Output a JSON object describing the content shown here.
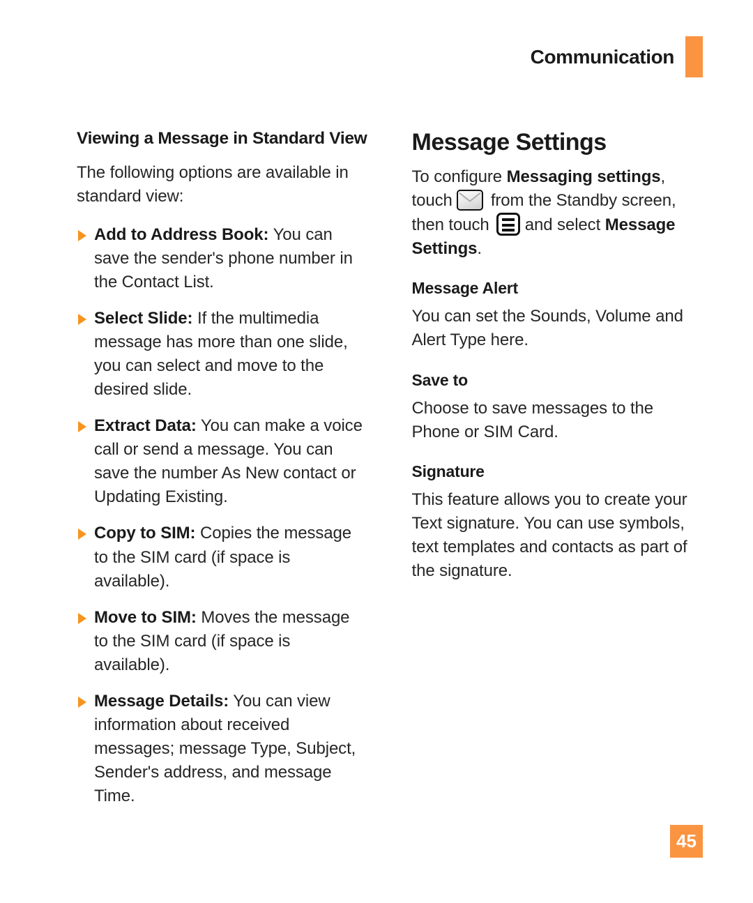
{
  "header": {
    "title": "Communication",
    "tab_color": "#fb9441"
  },
  "left_column": {
    "heading": "Viewing a Message in Standard View",
    "intro": "The following options are available in standard view:",
    "bullets": [
      {
        "term": "Add to Address Book:",
        "text": " You can save the sender's phone number in the Contact List."
      },
      {
        "term": "Select Slide:",
        "text": " If the multimedia message has more than one slide, you can select and move to the desired slide."
      },
      {
        "term": "Extract Data:",
        "text": " You can make a voice call or send a message. You can save the number As New contact or Updating Existing."
      },
      {
        "term": "Copy to SIM:",
        "text": " Copies the message to the SIM card (if space is available)."
      },
      {
        "term": "Move to SIM:",
        "text": " Moves the message to the SIM card (if space is available)."
      },
      {
        "term": "Message Details:",
        "text": " You can view information about received messages; message Type, Subject, Sender's address, and message Time."
      }
    ],
    "bullet_color": "#f7941e"
  },
  "right_column": {
    "heading": "Message Settings",
    "intro": {
      "part1": "To configure ",
      "bold1": "Messaging settings",
      "part2": ", touch ",
      "envelope_icon": "envelope-icon",
      "part3": " from the Standby screen, then touch ",
      "menu_icon": "menu-icon",
      "part4": " and select ",
      "bold2": "Message Settings",
      "part5": "."
    },
    "sections": [
      {
        "heading": "Message Alert",
        "body": "You can set the Sounds, Volume and Alert Type here."
      },
      {
        "heading": "Save to",
        "body": "Choose to save messages to the Phone or SIM Card."
      },
      {
        "heading": "Signature",
        "body": "This feature allows you to create your Text signature. You can use symbols, text templates and contacts as part of the signature."
      }
    ]
  },
  "footer": {
    "page_number": "45",
    "badge_color": "#fb9441"
  }
}
